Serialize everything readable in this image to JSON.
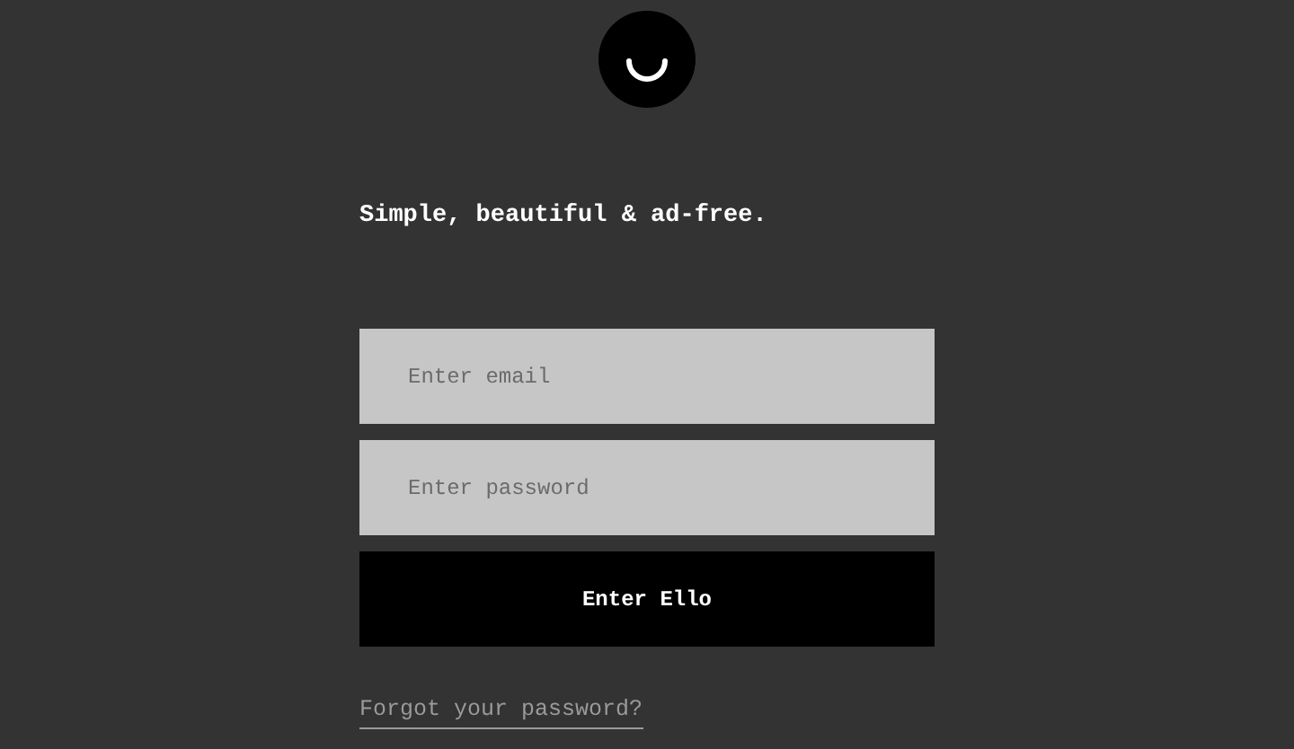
{
  "tagline": "Simple, beautiful & ad-free.",
  "email_field": {
    "placeholder": "Enter email"
  },
  "password_field": {
    "placeholder": "Enter password"
  },
  "submit_button": {
    "label": "Enter Ello"
  },
  "forgot_link": {
    "label": "Forgot your password?"
  }
}
